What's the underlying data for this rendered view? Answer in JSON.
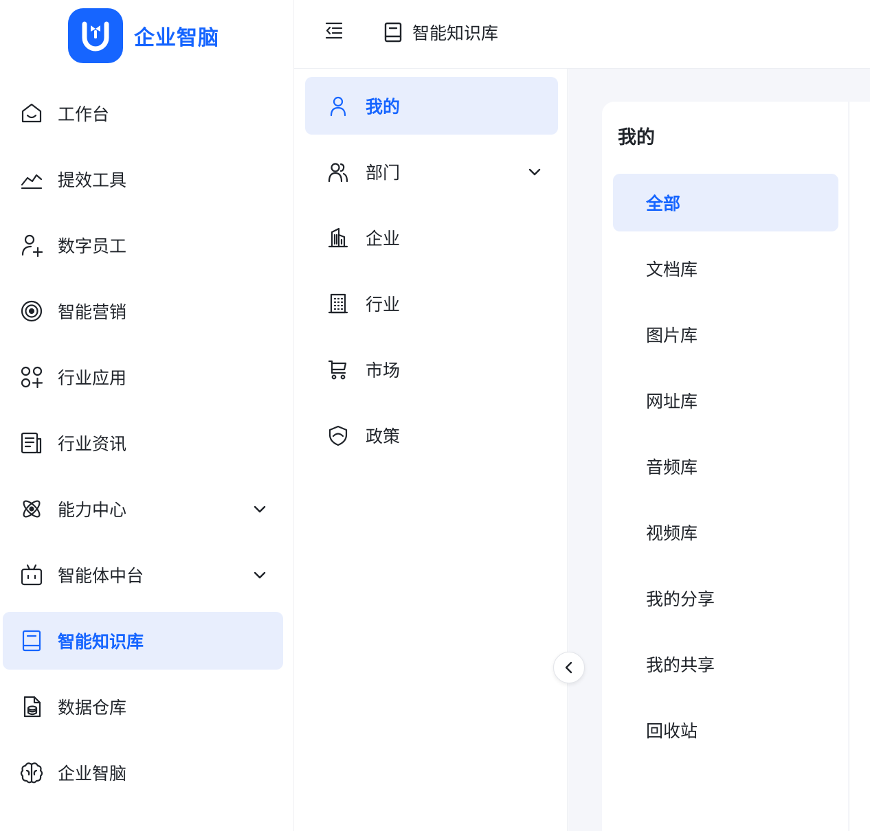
{
  "brand": {
    "name": "企业智脑"
  },
  "sidebar": {
    "items": [
      {
        "label": "工作台",
        "icon": "home-icon",
        "active": false,
        "expandable": false
      },
      {
        "label": "提效工具",
        "icon": "trend-icon",
        "active": false,
        "expandable": false
      },
      {
        "label": "数字员工",
        "icon": "user-add-icon",
        "active": false,
        "expandable": false
      },
      {
        "label": "智能营销",
        "icon": "target-icon",
        "active": false,
        "expandable": false
      },
      {
        "label": "行业应用",
        "icon": "apps-icon",
        "active": false,
        "expandable": false
      },
      {
        "label": "行业资讯",
        "icon": "news-icon",
        "active": false,
        "expandable": false
      },
      {
        "label": "能力中心",
        "icon": "atom-icon",
        "active": false,
        "expandable": true
      },
      {
        "label": "智能体中台",
        "icon": "robot-icon",
        "active": false,
        "expandable": true
      },
      {
        "label": "智能知识库",
        "icon": "book-icon",
        "active": true,
        "expandable": false
      },
      {
        "label": "数据仓库",
        "icon": "database-file-icon",
        "active": false,
        "expandable": false
      },
      {
        "label": "企业智脑",
        "icon": "brain-icon",
        "active": false,
        "expandable": false
      }
    ]
  },
  "header": {
    "title": "智能知识库",
    "title_icon": "book-icon"
  },
  "subnav": {
    "items": [
      {
        "label": "我的",
        "icon": "user-icon",
        "active": true,
        "expandable": false
      },
      {
        "label": "部门",
        "icon": "users-icon",
        "active": false,
        "expandable": true
      },
      {
        "label": "企业",
        "icon": "building-icon",
        "active": false,
        "expandable": false
      },
      {
        "label": "行业",
        "icon": "office-icon",
        "active": false,
        "expandable": false
      },
      {
        "label": "市场",
        "icon": "cart-icon",
        "active": false,
        "expandable": false
      },
      {
        "label": "政策",
        "icon": "shield-icon",
        "active": false,
        "expandable": false
      }
    ]
  },
  "panel": {
    "title": "我的",
    "categories": [
      {
        "label": "全部",
        "active": true
      },
      {
        "label": "文档库",
        "active": false
      },
      {
        "label": "图片库",
        "active": false
      },
      {
        "label": "网址库",
        "active": false
      },
      {
        "label": "音频库",
        "active": false
      },
      {
        "label": "视频库",
        "active": false
      },
      {
        "label": "我的分享",
        "active": false
      },
      {
        "label": "我的共享",
        "active": false
      },
      {
        "label": "回收站",
        "active": false
      }
    ]
  },
  "colors": {
    "accent": "#1665ff",
    "active_bg": "#e8eefd",
    "main_bg": "#f5f6fa",
    "text": "#1f2329"
  }
}
